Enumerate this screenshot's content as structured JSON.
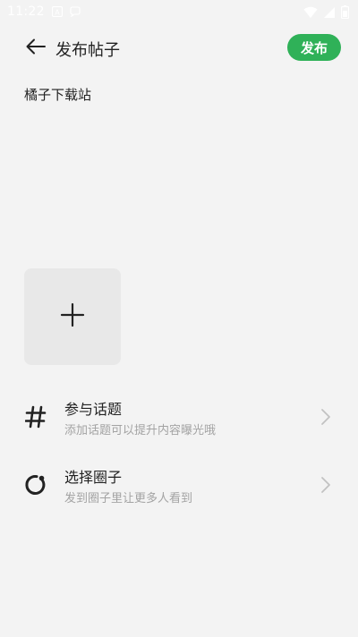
{
  "status_bar": {
    "time": "11:22",
    "left_icons": [
      "notification-a-icon",
      "message-icon"
    ],
    "right_icons": [
      "wifi-icon",
      "signal-icon",
      "battery-icon"
    ]
  },
  "header": {
    "title": "发布帖子",
    "publish_label": "发布",
    "accent": "#2fb158"
  },
  "post": {
    "text": "橘子下载站"
  },
  "media": {
    "add_icon": "plus-icon"
  },
  "options": [
    {
      "icon": "hashtag-icon",
      "title": "参与话题",
      "subtitle": "添加话题可以提升内容曝光哦"
    },
    {
      "icon": "circle-icon",
      "title": "选择圈子",
      "subtitle": "发到圈子里让更多人看到"
    }
  ]
}
